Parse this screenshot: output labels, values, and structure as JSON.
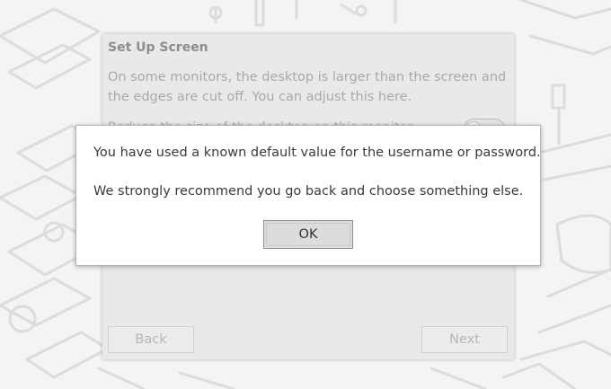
{
  "wizard": {
    "title": "Set Up Screen",
    "description": "On some monitors, the desktop is larger than the screen and the edges are cut off. You can adjust this here.",
    "option_label": "Reduce the size of the desktop on this monitor",
    "back_label": "Back",
    "next_label": "Next"
  },
  "dialog": {
    "message_line1": "You have used a known default value for the username or password.",
    "message_line2": "We strongly recommend you go back and choose something else.",
    "ok_label": "OK"
  }
}
